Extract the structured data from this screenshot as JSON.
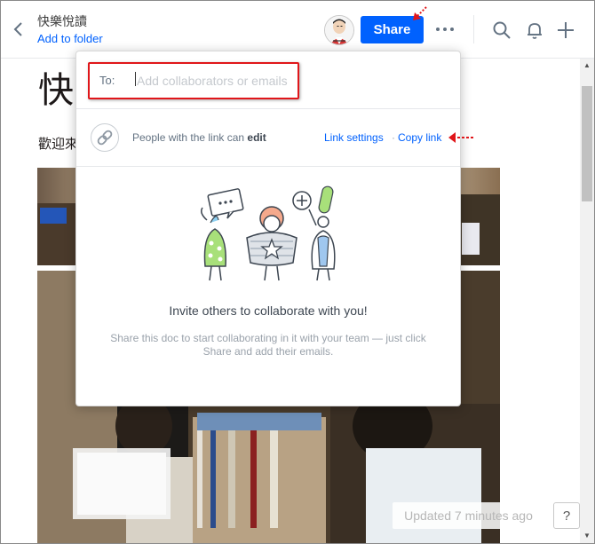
{
  "header": {
    "doc_title": "快樂悅讀",
    "add_to_folder": "Add to folder",
    "share_label": "Share",
    "icons": [
      "back-chevron-icon",
      "more-icon",
      "search-icon",
      "bell-icon",
      "plus-icon"
    ]
  },
  "document": {
    "heading": "快",
    "text": "歡迎來"
  },
  "share_modal": {
    "to_label": "To:",
    "to_placeholder": "Add collaborators or emails",
    "link_text_prefix": "People with the link can",
    "link_permission": "edit",
    "link_settings": "Link settings",
    "separator": "·",
    "copy_link": "Copy link",
    "invite_title": "Invite others to collaborate with you!",
    "invite_subtitle": "Share this doc to start collaborating in it with your team — just click Share and add their emails."
  },
  "footer": {
    "updated": "Updated 7 minutes ago",
    "help": "?"
  },
  "colors": {
    "accent": "#0061fe",
    "highlight_red": "#e0161a"
  }
}
